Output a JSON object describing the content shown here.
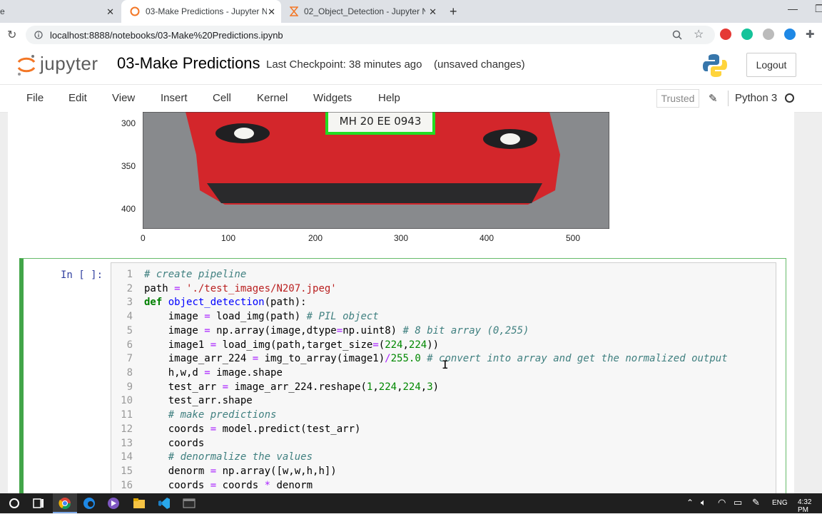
{
  "browser": {
    "tabs": [
      {
        "title": "e",
        "active": false
      },
      {
        "title": "03-Make Predictions - Jupyter N",
        "active": true
      },
      {
        "title": "02_Object_Detection - Jupyter N",
        "active": false
      }
    ],
    "url": "localhost:8888/notebooks/03-Make%20Predictions.ipynb"
  },
  "jupyter": {
    "logo_text": "jupyter",
    "notebook_title": "03-Make Predictions",
    "checkpoint": "Last Checkpoint: 38 minutes ago",
    "unsaved": "(unsaved changes)",
    "logout_label": "Logout",
    "menu": [
      "File",
      "Edit",
      "View",
      "Insert",
      "Cell",
      "Kernel",
      "Widgets",
      "Help"
    ],
    "trusted_label": "Trusted",
    "kernel_name": "Python 3"
  },
  "plot": {
    "plate_text": "MH 20 EE 0943",
    "y_ticks": [
      "300",
      "350",
      "400"
    ],
    "x_ticks": [
      "0",
      "100",
      "200",
      "300",
      "400",
      "500"
    ]
  },
  "cell": {
    "prompt": "In [ ]:",
    "line_numbers": [
      "1",
      "2",
      "3",
      "4",
      "5",
      "6",
      "7",
      "8",
      "9",
      "10",
      "11",
      "12",
      "13",
      "14",
      "15",
      "16"
    ]
  },
  "code": {
    "l1": "# create pipeline",
    "l2a": "path",
    "l2b": " = ",
    "l2c": "'./test_images/N207.jpeg'",
    "l3a": "def",
    "l3b": " object_detection",
    "l3c": "(path):",
    "l4a": "    image ",
    "l4b": "=",
    "l4c": " load_img(path) ",
    "l4d": "# PIL object",
    "l5a": "    image ",
    "l5b": "=",
    "l5c": " np.array(image,dtype",
    "l5d": "=",
    "l5e": "np.uint8) ",
    "l5f": "# 8 bit array (0,255)",
    "l6a": "    image1 ",
    "l6b": "=",
    "l6c": " load_img(path,target_size",
    "l6d": "=",
    "l6e": "(",
    "l6f": "224",
    "l6g": ",",
    "l6h": "224",
    "l6i": "))",
    "l7a": "    image_arr_224 ",
    "l7b": "=",
    "l7c": " img_to_array(image1)",
    "l7d": "/",
    "l7e": "255.0",
    "l7f": " ",
    "l7g": "# convert into array and get the normalized output",
    "l8a": "    h,w,d ",
    "l8b": "=",
    "l8c": " image.shape",
    "l9a": "    test_arr ",
    "l9b": "=",
    "l9c": " image_arr_224.reshape(",
    "l9d": "1",
    "l9e": ",",
    "l9f": "224",
    "l9g": ",",
    "l9h": "224",
    "l9i": ",",
    "l9j": "3",
    "l9k": ")",
    "l10": "    test_arr.shape",
    "l11": "    # make predictions",
    "l12a": "    coords ",
    "l12b": "=",
    "l12c": " model.predict(test_arr)",
    "l13": "    coords",
    "l14": "    # denormalize the values",
    "l15a": "    denorm ",
    "l15b": "=",
    "l15c": " np.array([w,w,h,h])",
    "l16a": "    coords ",
    "l16b": "=",
    "l16c": " coords ",
    "l16d": "*",
    "l16e": " denorm"
  },
  "taskbar": {
    "lang": "ENG",
    "time": "4:32 PM"
  }
}
